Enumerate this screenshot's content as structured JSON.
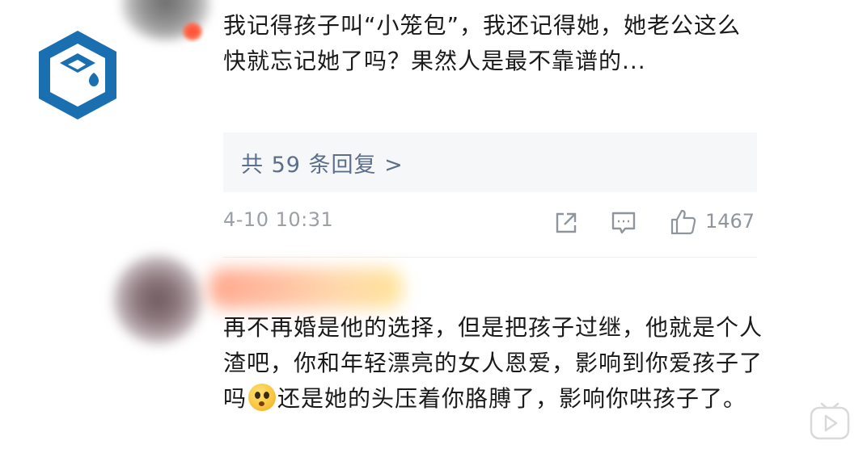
{
  "comments": [
    {
      "text": "我记得孩子叫“小笼包”，我还记得她，她老公这么快就忘记她了吗？果然人是最不靠谱的...",
      "replies_label": "共 59 条回复 >",
      "time": "4-10 10:31",
      "likes": "1467"
    },
    {
      "text_before_emoji": "再不再婚是他的选择，但是把孩子过继，他就是个人渣吧，你和年轻漂亮的女人恩爱，影响到你爱孩子了吗",
      "text_after_emoji": "还是她的头压着你胳膊了，影响你哄孩子了。"
    }
  ],
  "icons": {
    "share": "share-icon",
    "comment": "comment-icon",
    "like": "thumbs-up-icon",
    "play": "play-icon",
    "logo": "logo-icon",
    "emoji": "wondering-emoji-icon"
  },
  "colors": {
    "reply_link": "#5c6f8a",
    "meta_gray": "#9aa0a6",
    "logo_blue": "#1a6fb0"
  }
}
